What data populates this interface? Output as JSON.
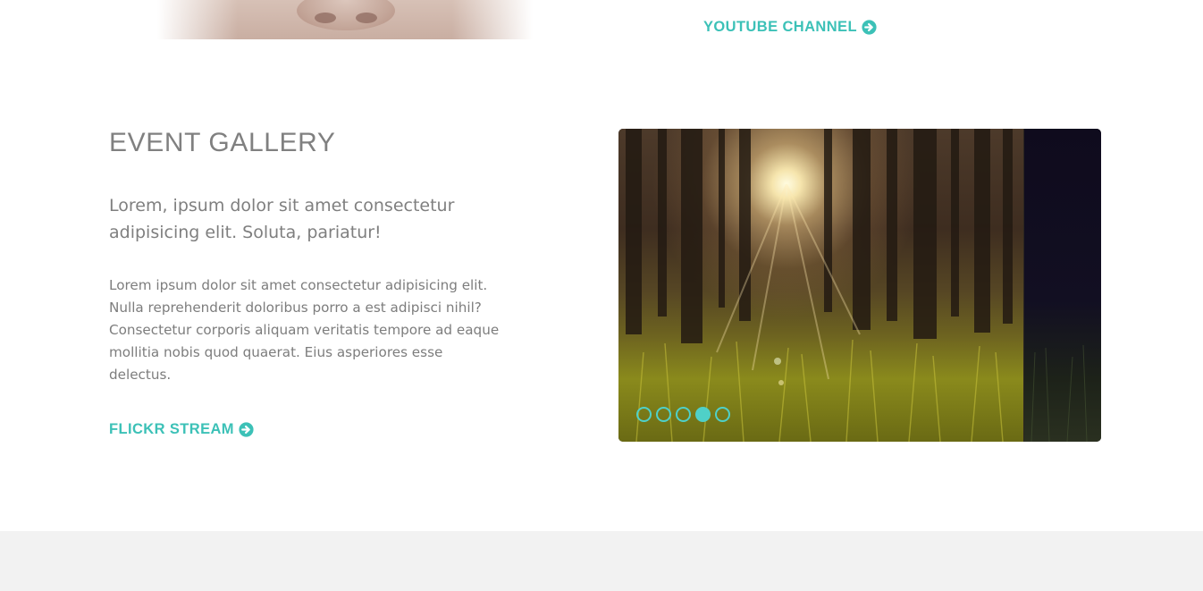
{
  "links": {
    "youtube_label": "YOUTUBE CHANNEL",
    "flickr_label": "FLICKR STREAM"
  },
  "event_gallery": {
    "title": "EVENT GALLERY",
    "lead": "Lorem, ipsum dolor sit amet consectetur adipisicing elit. Soluta, pariatur!",
    "body": "Lorem ipsum dolor sit amet consectetur adipisicing elit. Nulla reprehenderit doloribus porro a est adipisci nihil? Consectetur corporis aliquam veritatis tempore ad eaque mollitia nobis quod quaerat. Eius asperiores esse delectus."
  },
  "slider": {
    "slide_count": 5,
    "active_slide": 4
  },
  "icons": {
    "link_arrow": "circle-arrow-right-icon"
  },
  "colors": {
    "accent": "#3cc1b7",
    "heading": "#808080",
    "text": "#7d7d7d",
    "footer_band": "#f2f2f2"
  }
}
